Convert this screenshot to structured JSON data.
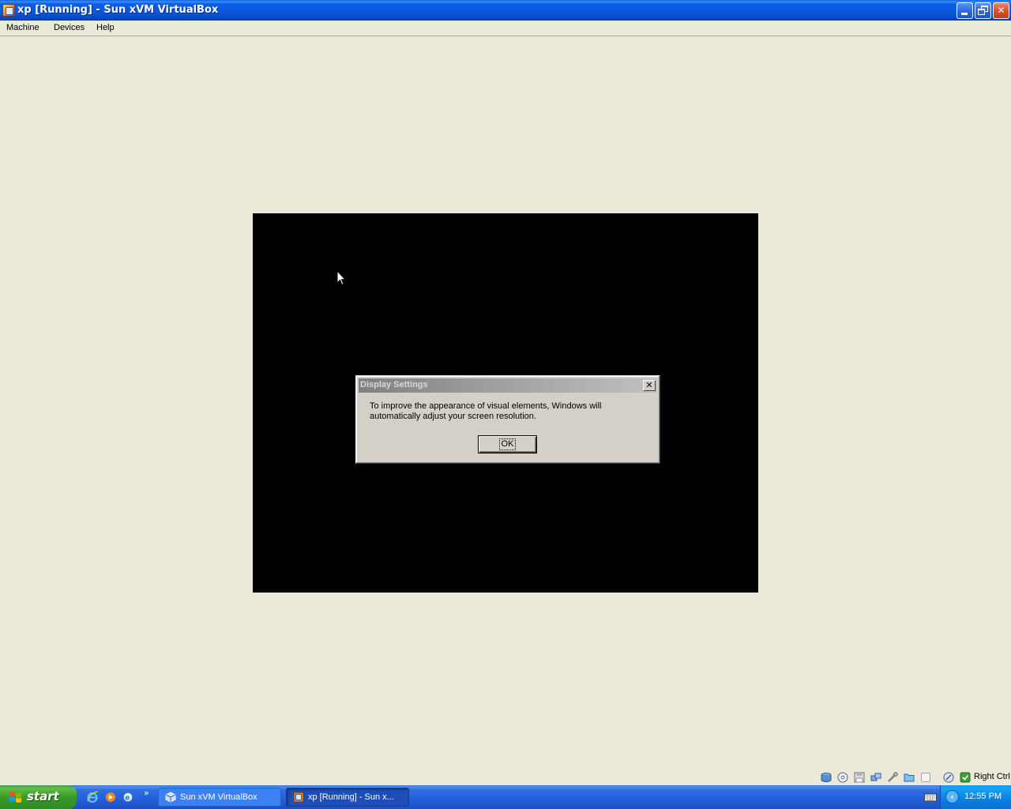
{
  "window": {
    "title": "xp [Running] - Sun xVM VirtualBox",
    "controls": {
      "minimize": "minimize",
      "maximize": "restore",
      "close": "close"
    }
  },
  "menubar": {
    "items": [
      "Machine",
      "Devices",
      "Help"
    ]
  },
  "dialog": {
    "title": "Display Settings",
    "message": "To improve the appearance of visual elements, Windows will automatically adjust your screen resolution.",
    "ok_label": "OK",
    "close_symbol": "✕"
  },
  "statusbar": {
    "icons": [
      "hard-disk-icon",
      "cd-dvd-icon",
      "floppy-icon",
      "network-icon",
      "usb-icon",
      "shared-folders-icon",
      "display-icon",
      "mouse-integration-icon",
      "host-key-icon"
    ],
    "host_key_label": "Right Ctrl"
  },
  "taskbar": {
    "start_label": "start",
    "quick_launch_icons": [
      "internet-explorer-icon",
      "media-player-icon",
      "browser-icon"
    ],
    "more_glyph": "»",
    "tasks": [
      {
        "label": "Sun xVM VirtualBox",
        "icon": "virtualbox-icon"
      },
      {
        "label": "xp [Running] - Sun x...",
        "icon": "vm-window-icon"
      }
    ],
    "tray_chevron": "‹",
    "clock": "12:55 PM"
  },
  "colors": {
    "titlebar": "#0a58da",
    "window_bg": "#ece9d8",
    "vm_screen": "#000000",
    "dialog_bg": "#d4d0c8",
    "taskbar": "#245edb",
    "start_button": "#3a9a2b"
  }
}
